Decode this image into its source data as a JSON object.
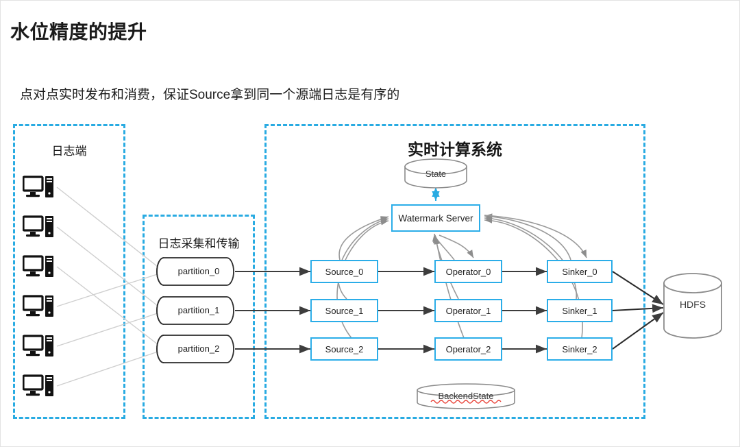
{
  "slide": {
    "title": "水位精度的提升",
    "subtitle": "点对点实时发布和消费，保证Source拿到同一个源端日志是有序的"
  },
  "colors": {
    "panel_border": "#29ABE2",
    "node_border": "#2BADE8",
    "wire_gray": "#c8c8c8",
    "arrow_dark": "#3d3d3d",
    "cylinder_stroke": "#8a8a8a",
    "text": "#1f1f1f"
  },
  "panels": [
    {
      "id": "log-endpoint",
      "title": "日志端"
    },
    {
      "id": "log-collect",
      "title": "日志采集和传输"
    },
    {
      "id": "realtime-compute",
      "title": "实时计算系统"
    }
  ],
  "log_endpoints": {
    "icon": "desktop-computer-icon",
    "count": 6,
    "items": [
      {
        "name": "log-endpoint-1"
      },
      {
        "name": "log-endpoint-2"
      },
      {
        "name": "log-endpoint-3"
      },
      {
        "name": "log-endpoint-4"
      },
      {
        "name": "log-endpoint-5"
      },
      {
        "name": "log-endpoint-6"
      }
    ]
  },
  "partitions": [
    {
      "label": "partition_0"
    },
    {
      "label": "partition_1"
    },
    {
      "label": "partition_2"
    }
  ],
  "pipeline": {
    "sources": [
      {
        "label": "Source_0"
      },
      {
        "label": "Source_1"
      },
      {
        "label": "Source_2"
      }
    ],
    "operators": [
      {
        "label": "Operator_0"
      },
      {
        "label": "Operator_1"
      },
      {
        "label": "Operator_2"
      }
    ],
    "sinkers": [
      {
        "label": "Sinker_0"
      },
      {
        "label": "Sinker_1"
      },
      {
        "label": "Sinker_2"
      }
    ]
  },
  "stores": {
    "state": {
      "label": "State",
      "shape": "cylinder-horizontal-disc"
    },
    "backend_state": {
      "label": "BackendState",
      "shape": "cylinder-flat-disc",
      "misspelled": true
    },
    "hdfs": {
      "label": "HDFS",
      "shape": "cylinder-vertical"
    }
  },
  "watermark_server": {
    "label": "Watermark Server"
  }
}
